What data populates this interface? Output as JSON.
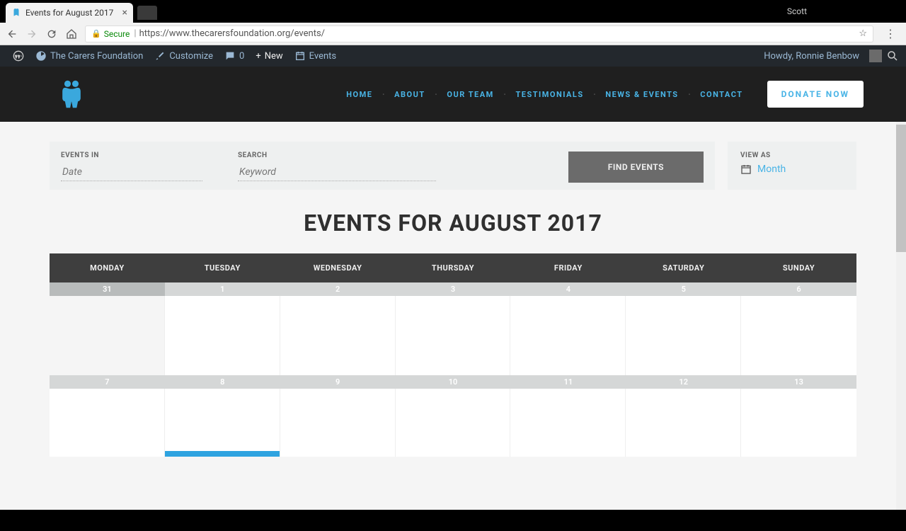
{
  "browser": {
    "tab_title": "Events for August 2017",
    "profile": "Scott",
    "secure_label": "Secure",
    "url": "https://www.thecarersfoundation.org/events/"
  },
  "wp_bar": {
    "site_name": "The Carers Foundation",
    "customize": "Customize",
    "comments": "0",
    "new": "New",
    "events": "Events",
    "howdy": "Howdy, Ronnie Benbow"
  },
  "nav": {
    "items": [
      "HOME",
      "ABOUT",
      "OUR TEAM",
      "TESTIMONIALS",
      "NEWS & EVENTS",
      "CONTACT"
    ],
    "donate": "DONATE NOW"
  },
  "filters": {
    "events_in_label": "EVENTS IN",
    "events_in_placeholder": "Date",
    "search_label": "SEARCH",
    "search_placeholder": "Keyword",
    "find_button": "FIND EVENTS",
    "view_as_label": "VIEW AS",
    "view_value": "Month"
  },
  "page_title": "EVENTS FOR AUGUST 2017",
  "calendar": {
    "days": [
      "MONDAY",
      "TUESDAY",
      "WEDNESDAY",
      "THURSDAY",
      "FRIDAY",
      "SATURDAY",
      "SUNDAY"
    ],
    "row1": [
      {
        "n": "31",
        "prev": true
      },
      {
        "n": "1"
      },
      {
        "n": "2"
      },
      {
        "n": "3"
      },
      {
        "n": "4"
      },
      {
        "n": "5"
      },
      {
        "n": "6"
      }
    ],
    "row2": [
      {
        "n": "7"
      },
      {
        "n": "8",
        "today": true
      },
      {
        "n": "9"
      },
      {
        "n": "10"
      },
      {
        "n": "11"
      },
      {
        "n": "12"
      },
      {
        "n": "13"
      }
    ]
  }
}
